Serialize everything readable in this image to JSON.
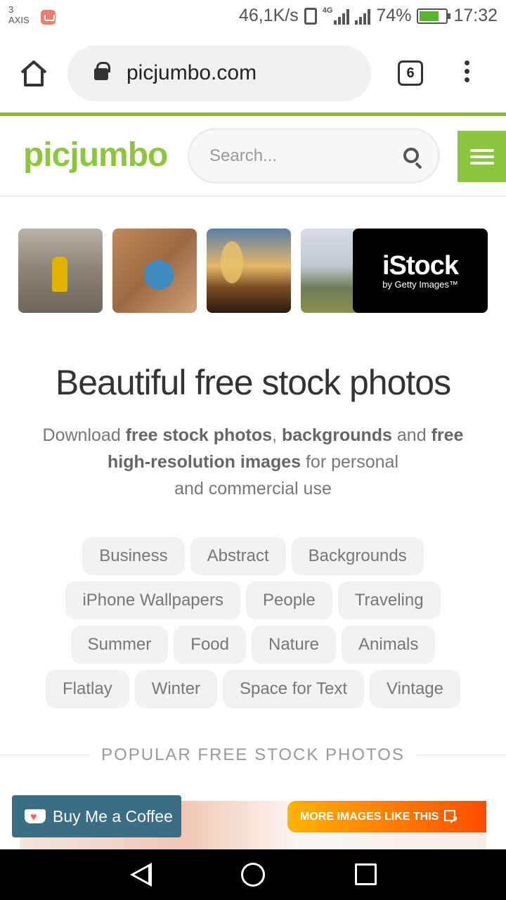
{
  "status_bar": {
    "carrier_number": "3",
    "carrier_name": "AXIS",
    "speed": "46,1K/s",
    "network": "4G",
    "battery": "74%",
    "time": "17:32"
  },
  "browser": {
    "url": "picjumbo.com",
    "tab_count": "6"
  },
  "site": {
    "logo": "picjumbo",
    "search_placeholder": "Search..."
  },
  "ad": {
    "logo": "iStock",
    "subtitle": "by Getty Images™"
  },
  "hero": {
    "title": "Beautiful free stock photos",
    "desc_1": "Download ",
    "desc_bold_1": "free stock photos",
    "desc_2": ", ",
    "desc_bold_2": "backgrounds",
    "desc_3": " and ",
    "desc_bold_3": "free high-resolution images",
    "desc_4": " for personal",
    "desc_5": "and commercial use"
  },
  "tags": {
    "row1": [
      "Business",
      "Abstract",
      "Backgrounds"
    ],
    "row2": [
      "iPhone Wallpapers",
      "People",
      "Traveling"
    ],
    "row3": [
      "Summer",
      "Food",
      "Nature",
      "Animals"
    ],
    "row4": [
      "Flatlay",
      "Winter",
      "Space for Text",
      "Vintage"
    ]
  },
  "popular": {
    "heading": "POPULAR FREE STOCK PHOTOS"
  },
  "buttons": {
    "coffee": "Buy Me a Coffee",
    "more_images": "MORE IMAGES LIKE THIS"
  },
  "colors": {
    "brand_green": "#8cc63e",
    "coffee_blue": "#3b6d84",
    "more_images_orange": "#ff7a00"
  }
}
